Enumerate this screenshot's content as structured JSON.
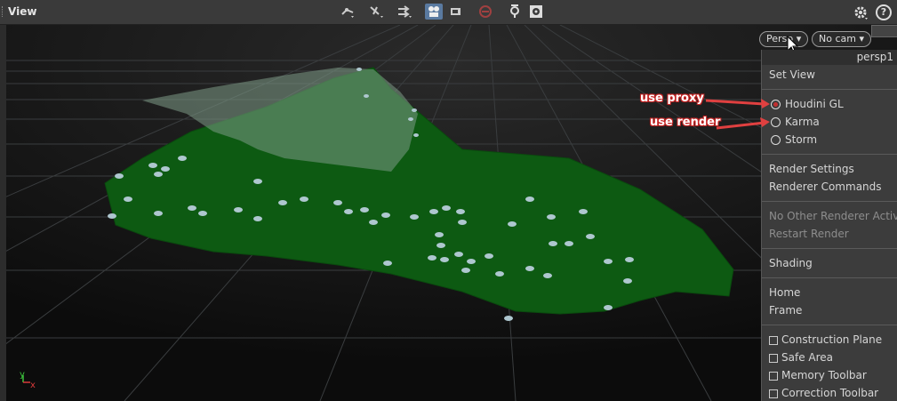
{
  "header": {
    "title": "View"
  },
  "toolbar": {
    "icons": [
      "select-tool-icon",
      "move-handle-icon",
      "display-options-icon",
      "scene-view-icon",
      "camera-icon",
      "no-entry-icon",
      "render-icon",
      "snapshot-icon",
      "gear-icon",
      "help-icon"
    ],
    "help_label": "?"
  },
  "viewport": {
    "persp_button": "Persp",
    "camera_button": "No cam",
    "axes": {
      "y": "y",
      "x": "x"
    }
  },
  "menu": {
    "header": "persp1",
    "set_view": "Set View",
    "renderers": [
      {
        "label": "Houdini GL",
        "selected": true
      },
      {
        "label": "Karma",
        "selected": false
      },
      {
        "label": "Storm",
        "selected": false
      }
    ],
    "render_settings": "Render Settings",
    "renderer_commands": "Renderer Commands",
    "no_other_renderer": "No Other Renderer Active",
    "restart_render": "Restart Render",
    "shading": "Shading",
    "home": "Home",
    "frame": "Frame",
    "checkboxes": [
      {
        "label": "Construction Plane",
        "checked": false
      },
      {
        "label": "Safe Area",
        "checked": false
      },
      {
        "label": "Memory Toolbar",
        "checked": false
      },
      {
        "label": "Correction Toolbar",
        "checked": false
      }
    ]
  },
  "annotations": {
    "proxy": "use proxy",
    "render": "use render"
  },
  "colors": {
    "accent_red": "#d63a3a",
    "terrain_green": "#0d5a12",
    "toolbar_active": "#5a7aa0"
  }
}
